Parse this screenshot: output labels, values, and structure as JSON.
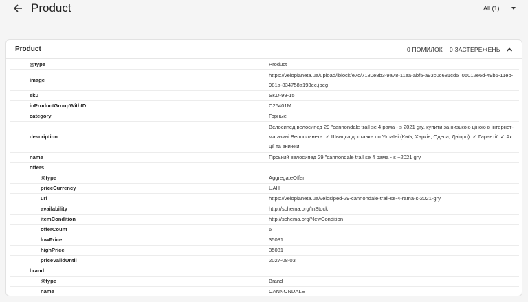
{
  "header": {
    "title": "Product",
    "filter_value": "All (1)"
  },
  "card": {
    "title": "Product",
    "errors": "0 ПОМИЛОК",
    "warnings": "0 ЗАСТЕРЕЖЕНЬ"
  },
  "rows": [
    {
      "key": "@type",
      "value": "Product",
      "level": 1
    },
    {
      "key": "image",
      "value": "https://veloplaneta.ua/upload/iblock/e7c/7180e8b3-9a78-11ea-abf5-a93c0c681cd5_06012e6d-49b6-11eb-981a-834758a193ec.jpeg",
      "level": 1
    },
    {
      "key": "sku",
      "value": "SKD-99-15",
      "level": 1
    },
    {
      "key": "inProductGroupWithID",
      "value": "C26401M",
      "level": 1
    },
    {
      "key": "category",
      "value": "Горные",
      "level": 1
    },
    {
      "key": "description",
      "value": "Велосипед велосипед 29 \"cannondale trail se 4 рама - s 2021 gry. купити за низькою ціною в інтернет-магазині Велопланета. ✓ Швидка доставка по Україні (Київ, Харків, Одеса, Дніпро). ✓ Гарантії. ✓ Акції та знижки.",
      "level": 1
    },
    {
      "key": "name",
      "value": "Гірський велосипед 29 \"cannondale trail se 4 рама - s +2021 gry",
      "level": 1
    },
    {
      "key": "offers",
      "value": "",
      "level": 1
    },
    {
      "key": "@type",
      "value": "AggregateOffer",
      "level": 2
    },
    {
      "key": "priceCurrency",
      "value": "UAH",
      "level": 2
    },
    {
      "key": "url",
      "value": "https://veloplaneta.ua/velosiped-29-cannondale-trail-se-4-rama-s-2021-gry",
      "level": 2
    },
    {
      "key": "availability",
      "value": "http://schema.org/InStock",
      "level": 2
    },
    {
      "key": "itemCondition",
      "value": "http://schema.org/NewCondition",
      "level": 2
    },
    {
      "key": "offerCount",
      "value": "6",
      "level": 2
    },
    {
      "key": "lowPrice",
      "value": "35081",
      "level": 2
    },
    {
      "key": "highPrice",
      "value": "35081",
      "level": 2
    },
    {
      "key": "priceValidUntil",
      "value": "2027-08-03",
      "level": 2
    },
    {
      "key": "brand",
      "value": "",
      "level": 1
    },
    {
      "key": "@type",
      "value": "Brand",
      "level": 2
    },
    {
      "key": "name",
      "value": "CANNONDALE",
      "level": 2
    }
  ],
  "icons": {
    "back": "arrow-left-icon",
    "collapse": "chevron-up-icon",
    "filter": "caret-down-icon"
  }
}
